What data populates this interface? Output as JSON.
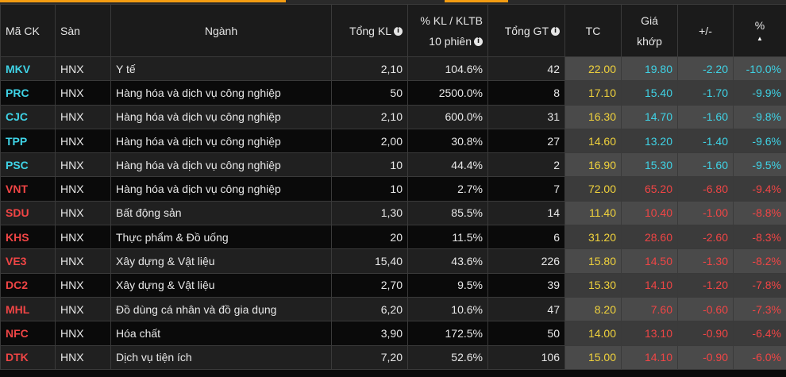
{
  "colors": {
    "up_cyan": "#3fd3e6",
    "down_red": "#f04545",
    "ref_yellow": "#f0d23c",
    "accent": "#f39c12"
  },
  "headers": {
    "symbol": "Mã CK",
    "exchange": "Sàn",
    "industry": "Ngành",
    "total_volume": "Tổng KL",
    "pct_volume_line1": "% KL / KLTB",
    "pct_volume_line2": "10 phiên",
    "total_value": "Tổng GT",
    "ref_price": "TC",
    "match_price_line1": "Giá",
    "match_price_line2": "khớp",
    "change": "+/-",
    "pct_change": "%",
    "info_icon": "i",
    "sort_icon": "▲"
  },
  "rows": [
    {
      "symbol": "MKV",
      "exchange": "HNX",
      "industry": "Y tế",
      "volume": "2,10",
      "pct_volume": "104.6%",
      "value": "42",
      "ref": "22.00",
      "match": "19.80",
      "change": "-2.20",
      "pct": "-10.0%",
      "color": "cyan"
    },
    {
      "symbol": "PRC",
      "exchange": "HNX",
      "industry": "Hàng hóa và dịch vụ công nghiệp",
      "volume": "50",
      "pct_volume": "2500.0%",
      "value": "8",
      "ref": "17.10",
      "match": "15.40",
      "change": "-1.70",
      "pct": "-9.9%",
      "color": "cyan"
    },
    {
      "symbol": "CJC",
      "exchange": "HNX",
      "industry": "Hàng hóa và dịch vụ công nghiệp",
      "volume": "2,10",
      "pct_volume": "600.0%",
      "value": "31",
      "ref": "16.30",
      "match": "14.70",
      "change": "-1.60",
      "pct": "-9.8%",
      "color": "cyan"
    },
    {
      "symbol": "TPP",
      "exchange": "HNX",
      "industry": "Hàng hóa và dịch vụ công nghiệp",
      "volume": "2,00",
      "pct_volume": "30.8%",
      "value": "27",
      "ref": "14.60",
      "match": "13.20",
      "change": "-1.40",
      "pct": "-9.6%",
      "color": "cyan"
    },
    {
      "symbol": "PSC",
      "exchange": "HNX",
      "industry": "Hàng hóa và dịch vụ công nghiệp",
      "volume": "10",
      "pct_volume": "44.4%",
      "value": "2",
      "ref": "16.90",
      "match": "15.30",
      "change": "-1.60",
      "pct": "-9.5%",
      "color": "cyan"
    },
    {
      "symbol": "VNT",
      "exchange": "HNX",
      "industry": "Hàng hóa và dịch vụ công nghiệp",
      "volume": "10",
      "pct_volume": "2.7%",
      "value": "7",
      "ref": "72.00",
      "match": "65.20",
      "change": "-6.80",
      "pct": "-9.4%",
      "color": "red"
    },
    {
      "symbol": "SDU",
      "exchange": "HNX",
      "industry": "Bất động sản",
      "volume": "1,30",
      "pct_volume": "85.5%",
      "value": "14",
      "ref": "11.40",
      "match": "10.40",
      "change": "-1.00",
      "pct": "-8.8%",
      "color": "red"
    },
    {
      "symbol": "KHS",
      "exchange": "HNX",
      "industry": "Thực phẩm & Đồ uống",
      "volume": "20",
      "pct_volume": "11.5%",
      "value": "6",
      "ref": "31.20",
      "match": "28.60",
      "change": "-2.60",
      "pct": "-8.3%",
      "color": "red"
    },
    {
      "symbol": "VE3",
      "exchange": "HNX",
      "industry": "Xây dựng & Vật liệu",
      "volume": "15,40",
      "pct_volume": "43.6%",
      "value": "226",
      "ref": "15.80",
      "match": "14.50",
      "change": "-1.30",
      "pct": "-8.2%",
      "color": "red"
    },
    {
      "symbol": "DC2",
      "exchange": "HNX",
      "industry": "Xây dựng & Vật liệu",
      "volume": "2,70",
      "pct_volume": "9.5%",
      "value": "39",
      "ref": "15.30",
      "match": "14.10",
      "change": "-1.20",
      "pct": "-7.8%",
      "color": "red"
    },
    {
      "symbol": "MHL",
      "exchange": "HNX",
      "industry": "Đồ dùng cá nhân và đồ gia dụng",
      "volume": "6,20",
      "pct_volume": "10.6%",
      "value": "47",
      "ref": "8.20",
      "match": "7.60",
      "change": "-0.60",
      "pct": "-7.3%",
      "color": "red"
    },
    {
      "symbol": "NFC",
      "exchange": "HNX",
      "industry": "Hóa chất",
      "volume": "3,90",
      "pct_volume": "172.5%",
      "value": "50",
      "ref": "14.00",
      "match": "13.10",
      "change": "-0.90",
      "pct": "-6.4%",
      "color": "red"
    },
    {
      "symbol": "DTK",
      "exchange": "HNX",
      "industry": "Dịch vụ tiện ích",
      "volume": "7,20",
      "pct_volume": "52.6%",
      "value": "106",
      "ref": "15.00",
      "match": "14.10",
      "change": "-0.90",
      "pct": "-6.0%",
      "color": "red"
    }
  ]
}
